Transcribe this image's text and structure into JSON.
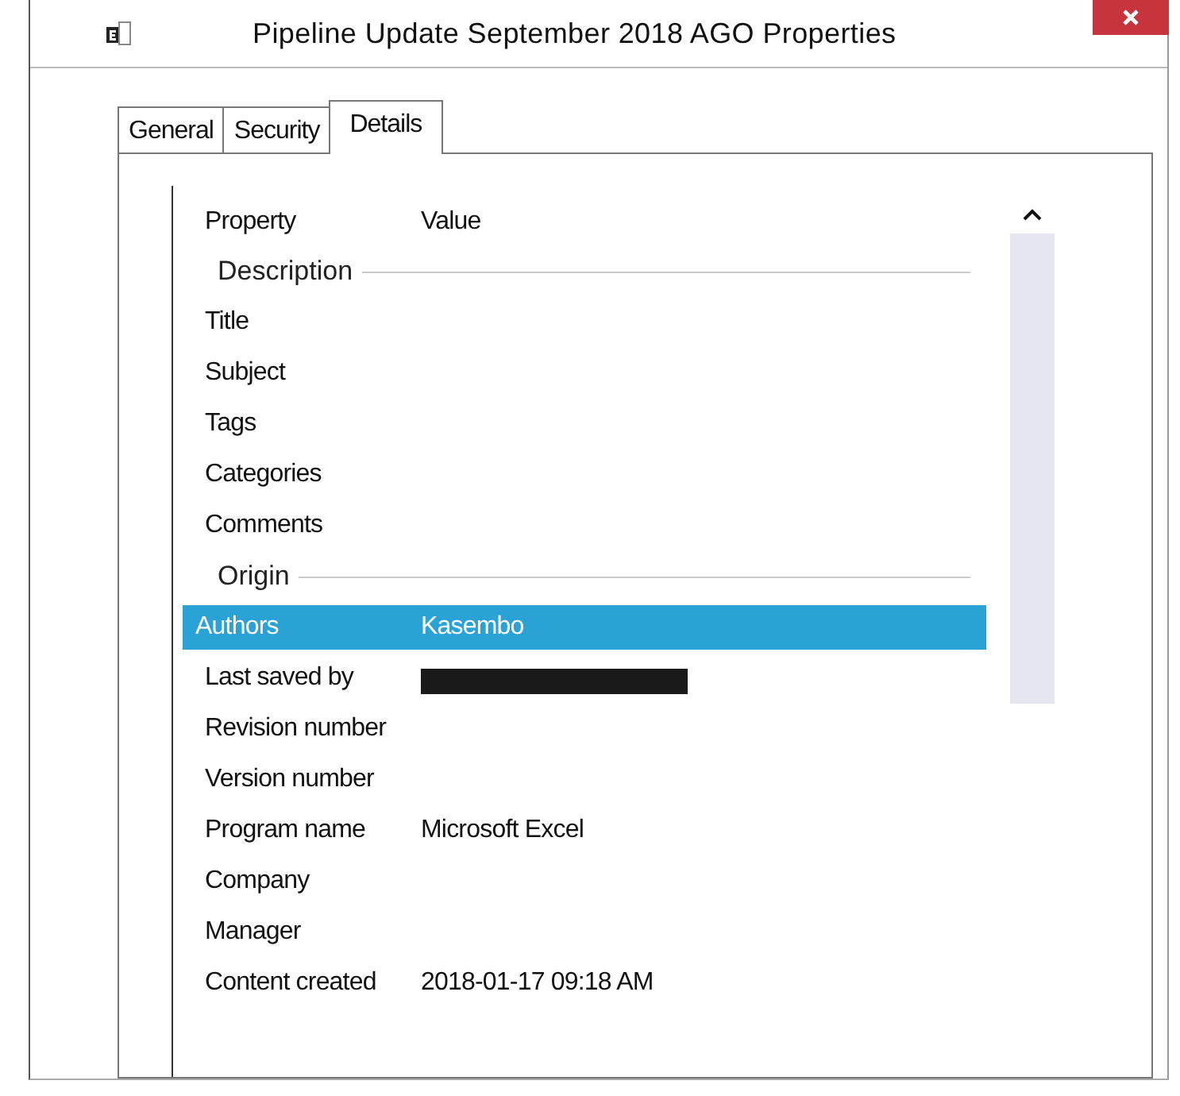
{
  "window": {
    "title": "Pipeline Update September 2018  AGO Properties"
  },
  "tabs": [
    {
      "label": "General",
      "selected": false
    },
    {
      "label": "Security",
      "selected": false
    },
    {
      "label": "Details",
      "selected": true
    }
  ],
  "columns": [
    "Property",
    "Value"
  ],
  "rows": [
    {
      "kind": "group",
      "label": "Description"
    },
    {
      "kind": "property",
      "name": "Title",
      "selected": false
    },
    {
      "kind": "property",
      "name": "Subject",
      "selected": false
    },
    {
      "kind": "property",
      "name": "Tags",
      "selected": false
    },
    {
      "kind": "property",
      "name": "Categories",
      "selected": false
    },
    {
      "kind": "property",
      "name": "Comments",
      "selected": false
    },
    {
      "kind": "group",
      "label": "Origin"
    },
    {
      "kind": "property",
      "name": "Authors",
      "value": "Kasembo",
      "selected": true
    },
    {
      "kind": "property",
      "name": "Last saved by",
      "redacted": true,
      "selected": false
    },
    {
      "kind": "property",
      "name": "Revision number",
      "selected": false
    },
    {
      "kind": "property",
      "name": "Version number",
      "selected": false
    },
    {
      "kind": "property",
      "name": "Program name",
      "value": "Microsoft Excel",
      "selected": false
    },
    {
      "kind": "property",
      "name": "Company",
      "selected": false
    },
    {
      "kind": "property",
      "name": "Manager",
      "selected": false
    },
    {
      "kind": "property",
      "name": "Content created",
      "value": "2018-01-17 09:18 AM",
      "selected": false
    }
  ]
}
